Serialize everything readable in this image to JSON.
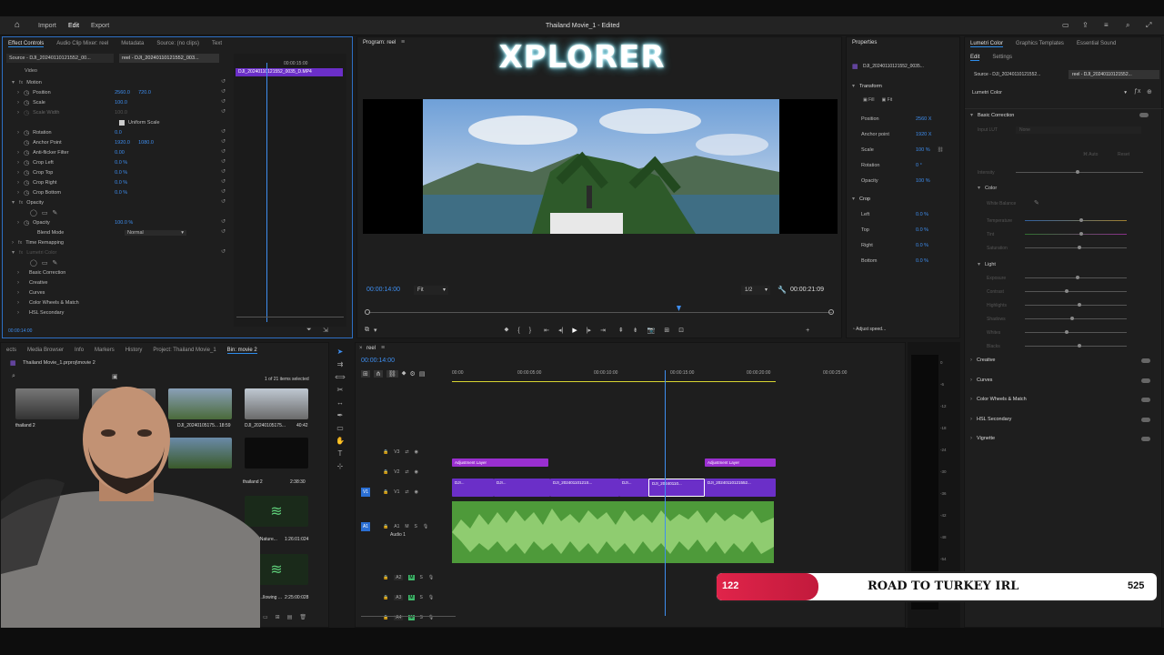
{
  "topbar": {
    "menu": [
      "Import",
      "Edit",
      "Export"
    ],
    "active_menu": "Edit",
    "project_title": "Thailand Movie_1 - Edited"
  },
  "effect_controls": {
    "tabs": [
      "Effect Controls",
      "Audio Clip Mixer: reel",
      "Metadata",
      "Source: (no clips)",
      "Text"
    ],
    "source_label": "Source - DJI_20240110121552_00...",
    "seq_label": "reel - DJI_20240110121552_003...",
    "clip_name": "DJI_20240110121552_0035_D.MP4",
    "timecode_head": "00:00:15:00",
    "section_video": "Video",
    "motion": "Motion",
    "position_label": "Position",
    "position_x": "2560.0",
    "position_y": "720.0",
    "scale_label": "Scale",
    "scale_val": "100.0",
    "scale_width_label": "Scale Width",
    "scale_width_val": "100.0",
    "uniform_scale": "Uniform Scale",
    "rotation_label": "Rotation",
    "rotation_val": "0.0",
    "anchor_label": "Anchor Point",
    "anchor_x": "1920.0",
    "anchor_y": "1080.0",
    "antiflicker_label": "Anti-flicker Filter",
    "antiflicker_val": "0.00",
    "crop_left_label": "Crop Left",
    "crop_left_val": "0.0 %",
    "crop_top_label": "Crop Top",
    "crop_top_val": "0.0 %",
    "crop_right_label": "Crop Right",
    "crop_right_val": "0.0 %",
    "crop_bottom_label": "Crop Bottom",
    "crop_bottom_val": "0.0 %",
    "opacity_section": "Opacity",
    "opacity_label": "Opacity",
    "opacity_val": "100.0 %",
    "blend_label": "Blend Mode",
    "blend_val": "Normal",
    "time_remap": "Time Remapping",
    "lumetri": "Lumetri Color",
    "basic_correction": "Basic Correction",
    "creative": "Creative",
    "curves": "Curves",
    "color_wheels": "Color Wheels & Match",
    "hsl": "HSL Secondary",
    "bottom_timecode": "00:00:14:00"
  },
  "program": {
    "title": "Program: reel",
    "overlay_logo": "XPLORER",
    "timecode": "00:00:14:00",
    "fit": "Fit",
    "resolution": "1/2",
    "duration": "00:00:21:09"
  },
  "properties": {
    "title": "Properties",
    "clip_name": "DJI_20240110121552_0035...",
    "transform": "Transform",
    "fill": "Fill",
    "fit": "Fit",
    "position_label": "Position",
    "position_val": "2560 X",
    "anchor_label": "Anchor point",
    "anchor_val": "1920 X",
    "scale_label": "Scale",
    "scale_val": "100 %",
    "rotation_label": "Rotation",
    "rotation_val": "0 °",
    "opacity_label": "Opacity",
    "opacity_val": "100 %",
    "crop": "Crop",
    "left_label": "Left",
    "left_val": "0.0 %",
    "top_label": "Top",
    "top_val": "0.0 %",
    "right_label": "Right",
    "right_val": "0.0 %",
    "bottom_label": "Bottom",
    "bottom_val": "0.0 %",
    "adjust_speed": "Adjust speed..."
  },
  "lumetri": {
    "tabs": [
      "Lumetri Color",
      "Graphics Templates",
      "Essential Sound"
    ],
    "subtabs": [
      "Edit",
      "Settings"
    ],
    "source": "Source - DJI_20240110121552...",
    "seq": "reel - DJI_20240110121552...",
    "dropdown": "Lumetri Color",
    "basic_correction": "Basic Correction",
    "input_lut_label": "Input LUT",
    "input_lut_val": "None",
    "auto": "Auto",
    "reset": "Reset",
    "intensity": "Intensity",
    "color": "Color",
    "white_balance": "White Balance",
    "temperature": "Temperature",
    "tint": "Tint",
    "saturation": "Saturation",
    "light": "Light",
    "light_items": [
      "Exposure",
      "Contrast",
      "Highlights",
      "Shadows",
      "Whites",
      "Blacks"
    ],
    "sections": [
      "Creative",
      "Curves",
      "Color Wheels & Match",
      "HSL Secondary",
      "Vignette"
    ]
  },
  "project": {
    "tabs": [
      "ects",
      "Media Browser",
      "Info",
      "Markers",
      "History",
      "Project: Thailand Movie_1",
      "Bin: movie 2"
    ],
    "path": "Thailand Movie_1.prproj\\movie 2",
    "selected": "1 of 21 items selected",
    "items": [
      {
        "name": "thailand 2",
        "dur": ""
      },
      {
        "name": "DJI_20240105175...",
        "dur": "18:59"
      },
      {
        "name": "DJI_20240105175...",
        "dur": "40:42"
      },
      {
        "name": "thailand 2",
        "dur": "2:38:30"
      },
      {
        "name": "...side Nature...",
        "dur": "1:26:01:024"
      },
      {
        "name": "...llowing ...",
        "dur": "2:25:00:028"
      }
    ]
  },
  "timeline": {
    "seq_name": "reel",
    "timecode": "00:00:14:00",
    "ruler": [
      "00:00",
      "00:00:05:00",
      "00:00:10:00",
      "00:00:15:00",
      "00:00:20:00",
      "00:00:25:00"
    ],
    "tracks": [
      "V3",
      "V2",
      "V1",
      "A1",
      "A2",
      "A3",
      "A4"
    ],
    "audio_label": "Audio 1",
    "adjustment_layer": "Adjustment Layer",
    "clip_labels": [
      "DJI...",
      "DJI...",
      "DJI_20240110121S...",
      "DJI...",
      "DJI_20240110...",
      "DJI_20240110121552..."
    ]
  },
  "overlay": {
    "left_count": "122",
    "title": "ROAD TO TURKEY IRL",
    "right_count": "525"
  },
  "meter_labels": [
    "0",
    "-6",
    "-12",
    "-18",
    "-24",
    "-30",
    "-36",
    "-42",
    "-48",
    "-54"
  ]
}
